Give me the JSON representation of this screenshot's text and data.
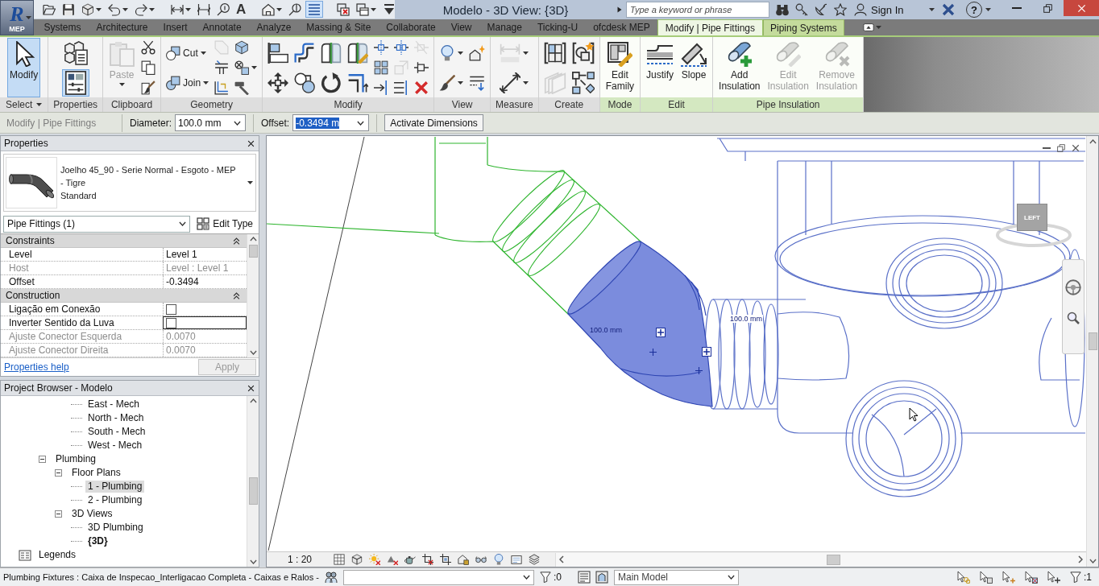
{
  "app_button": {
    "logo": "R",
    "label": "MEP"
  },
  "quick_access": [
    {
      "menu": false,
      "on": false
    },
    {
      "menu": false,
      "on": false
    },
    {
      "menu": true,
      "on": false
    },
    {
      "menu": true,
      "on": false
    },
    {
      "menu": true,
      "on": false
    },
    {
      "menu": true,
      "on": false
    },
    {
      "menu": false,
      "on": false
    },
    {
      "menu": false,
      "on": false
    },
    {
      "glyph": "A",
      "menu": false,
      "on": false
    },
    {
      "menu": true,
      "on": false
    },
    {
      "menu": false,
      "on": false
    },
    {
      "menu": false,
      "on": true
    },
    {
      "menu": false,
      "on": false
    },
    {
      "menu": true,
      "on": false
    },
    {
      "menu": false,
      "on": false
    }
  ],
  "window": {
    "title": "Modelo - 3D View: {3D}"
  },
  "search": {
    "placeholder": "Type a keyword or phrase"
  },
  "account": {
    "label": "Sign In"
  },
  "help": {
    "glyph": "?"
  },
  "ribbon_tabs": [
    {
      "label": "Systems",
      "selected": false,
      "contextual": false
    },
    {
      "label": "Architecture",
      "selected": false,
      "contextual": false
    },
    {
      "label": "Insert",
      "selected": false,
      "contextual": false
    },
    {
      "label": "Annotate",
      "selected": false,
      "contextual": false
    },
    {
      "label": "Analyze",
      "selected": false,
      "contextual": false
    },
    {
      "label": "Massing & Site",
      "selected": false,
      "contextual": false
    },
    {
      "label": "Collaborate",
      "selected": false,
      "contextual": false
    },
    {
      "label": "View",
      "selected": false,
      "contextual": false
    },
    {
      "label": "Manage",
      "selected": false,
      "contextual": false
    },
    {
      "label": "Ticking-U",
      "selected": false,
      "contextual": false
    },
    {
      "label": "ofcdesk MEP",
      "selected": false,
      "contextual": false
    },
    {
      "label": "Modify | Pipe Fittings",
      "selected": true,
      "contextual": true
    },
    {
      "label": "Piping Systems",
      "selected": false,
      "contextual": true
    }
  ],
  "ribbon_panels": [
    {
      "label": "Select",
      "menu": true,
      "contextual": false,
      "columns": [
        {
          "kind": "large",
          "tools": [
            {
              "label": "Modify",
              "menu": false,
              "disabled": false,
              "active": true
            }
          ]
        }
      ]
    },
    {
      "label": "Properties",
      "menu": false,
      "contextual": false,
      "columns": [
        {
          "kind": "stack",
          "tools": [
            {
              "menu": false,
              "disabled": false,
              "active": false
            },
            {
              "menu": false,
              "disabled": false,
              "active": true
            }
          ]
        }
      ]
    },
    {
      "label": "Clipboard",
      "menu": false,
      "contextual": false,
      "columns": [
        {
          "kind": "large",
          "tools": [
            {
              "label": "Paste",
              "menu": true,
              "disabled": true,
              "active": false
            }
          ]
        },
        {
          "kind": "stack",
          "tools": [
            {
              "menu": false,
              "disabled": false,
              "active": false
            },
            {
              "menu": false,
              "disabled": false,
              "active": false
            },
            {
              "menu": false,
              "disabled": false,
              "active": false
            }
          ]
        }
      ]
    },
    {
      "label": "Geometry",
      "menu": false,
      "contextual": false,
      "columns": [
        {
          "kind": "stack",
          "tools": [
            {
              "label": "Cut",
              "menu": true,
              "disabled": false,
              "active": false
            },
            {
              "label": "Join",
              "menu": true,
              "disabled": false,
              "active": false
            }
          ]
        },
        {
          "kind": "stack",
          "tools": [
            {
              "menu": false,
              "disabled": true,
              "active": false
            },
            {
              "menu": false,
              "disabled": false,
              "active": false
            },
            {
              "menu": false,
              "disabled": false,
              "active": false
            }
          ]
        },
        {
          "kind": "stack",
          "tools": [
            {
              "menu": false,
              "disabled": false,
              "active": false
            },
            {
              "menu": true,
              "disabled": false,
              "active": false
            },
            {
              "menu": false,
              "disabled": false,
              "active": false
            }
          ]
        }
      ]
    },
    {
      "label": "Modify",
      "menu": false,
      "contextual": false,
      "columns": [
        {
          "kind": "stack",
          "tools": [
            {
              "menu": false,
              "disabled": false,
              "active": false
            },
            {
              "menu": false,
              "disabled": false,
              "active": false
            }
          ]
        },
        {
          "kind": "stack",
          "tools": [
            {
              "menu": false,
              "disabled": false,
              "active": false
            },
            {
              "menu": false,
              "disabled": false,
              "active": false
            }
          ]
        },
        {
          "kind": "stack",
          "tools": [
            {
              "menu": false,
              "disabled": false,
              "active": false
            },
            {
              "menu": false,
              "disabled": false,
              "active": false
            }
          ]
        },
        {
          "kind": "stack",
          "tools": [
            {
              "menu": false,
              "disabled": false,
              "active": false
            },
            {
              "menu": false,
              "disabled": false,
              "active": false
            }
          ]
        },
        {
          "kind": "stack",
          "tools": [
            {
              "menu": false,
              "disabled": false,
              "active": false
            },
            {
              "menu": false,
              "disabled": false,
              "active": false
            },
            {
              "menu": false,
              "disabled": false,
              "active": false
            }
          ]
        },
        {
          "kind": "stack",
          "tools": [
            {
              "menu": false,
              "disabled": false,
              "active": false
            },
            {
              "menu": false,
              "disabled": true,
              "active": false
            },
            {
              "menu": false,
              "disabled": false,
              "active": false
            }
          ]
        },
        {
          "kind": "stack",
          "tools": [
            {
              "menu": false,
              "disabled": true,
              "active": false
            },
            {
              "menu": false,
              "disabled": false,
              "active": false
            },
            {
              "menu": false,
              "disabled": false,
              "active": false
            }
          ]
        }
      ]
    },
    {
      "label": "View",
      "menu": false,
      "contextual": false,
      "columns": [
        {
          "kind": "stack",
          "tools": [
            {
              "menu": true,
              "disabled": false,
              "active": false
            },
            {
              "menu": true,
              "disabled": false,
              "active": false
            }
          ]
        },
        {
          "kind": "stack",
          "tools": [
            {
              "menu": false,
              "disabled": false,
              "active": false
            },
            {
              "menu": false,
              "disabled": false,
              "active": false
            }
          ]
        }
      ]
    },
    {
      "label": "Measure",
      "menu": false,
      "contextual": false,
      "columns": [
        {
          "kind": "stack",
          "tools": [
            {
              "menu": true,
              "disabled": true,
              "active": false
            },
            {
              "menu": true,
              "disabled": false,
              "active": false
            }
          ]
        }
      ]
    },
    {
      "label": "Create",
      "menu": false,
      "contextual": false,
      "columns": [
        {
          "kind": "stack",
          "tools": [
            {
              "menu": false,
              "disabled": false,
              "active": false
            },
            {
              "menu": false,
              "disabled": true,
              "active": false
            }
          ]
        },
        {
          "kind": "stack",
          "tools": [
            {
              "menu": false,
              "disabled": false,
              "active": false
            },
            {
              "menu": false,
              "disabled": false,
              "active": false
            }
          ]
        }
      ]
    },
    {
      "label": "Mode",
      "menu": false,
      "contextual": true,
      "columns": [
        {
          "kind": "large",
          "tools": [
            {
              "label": "Edit Family",
              "menu": false,
              "disabled": false,
              "active": false
            }
          ]
        }
      ]
    },
    {
      "label": "Edit",
      "menu": false,
      "contextual": true,
      "columns": [
        {
          "kind": "large",
          "tools": [
            {
              "label": "Justify",
              "menu": false,
              "disabled": false,
              "active": false
            }
          ]
        },
        {
          "kind": "large",
          "tools": [
            {
              "label": "Slope",
              "menu": false,
              "disabled": false,
              "active": false
            }
          ]
        }
      ]
    },
    {
      "label": "Pipe Insulation",
      "menu": false,
      "contextual": true,
      "columns": [
        {
          "kind": "large",
          "tools": [
            {
              "label": "Add Insulation",
              "menu": false,
              "disabled": false,
              "active": false
            }
          ]
        },
        {
          "kind": "large",
          "tools": [
            {
              "label": "Edit Insulation",
              "menu": false,
              "disabled": true,
              "active": false
            }
          ]
        },
        {
          "kind": "large",
          "tools": [
            {
              "label": "Remove Insulation",
              "menu": false,
              "disabled": true,
              "active": false
            }
          ]
        }
      ]
    }
  ],
  "options_bar": {
    "context": "Modify | Pipe Fittings",
    "fields": [
      {
        "label": "Diameter:",
        "value": "100.0 mm",
        "text_selected": false
      },
      {
        "label": "Offset:",
        "value": "-0.3494 m",
        "text_selected": true
      }
    ],
    "button": "Activate Dimensions"
  },
  "properties": {
    "title": "Properties",
    "type": {
      "name": "Joelho 45_90 - Serie Normal - Esgoto - MEP - Tigre",
      "subtype": "Standard"
    },
    "filter": "Pipe Fittings (1)",
    "edit_type": "Edit Type",
    "groups": [
      {
        "label": "Constraints",
        "expanded": true,
        "rows": [
          {
            "name": "Level",
            "kind": "text",
            "value": "Level 1",
            "disabled": false
          },
          {
            "name": "Host",
            "kind": "text",
            "value": "Level : Level 1",
            "disabled": true
          },
          {
            "name": "Offset",
            "kind": "text",
            "value": "-0.3494",
            "disabled": false
          }
        ]
      },
      {
        "label": "Construction",
        "expanded": true,
        "rows": [
          {
            "name": "Ligação em Conexão",
            "kind": "checkbox",
            "checked": false,
            "focused": false,
            "disabled": false
          },
          {
            "name": "Inverter Sentido da Luva",
            "kind": "checkbox",
            "checked": false,
            "focused": true,
            "disabled": false
          },
          {
            "name": "Ajuste Conector Esquerda",
            "kind": "text",
            "value": "0.0070",
            "disabled": true
          },
          {
            "name": "Ajuste Conector Direita",
            "kind": "text",
            "value": "0.0070",
            "disabled": true
          }
        ]
      }
    ],
    "help_link": "Properties help",
    "apply": "Apply",
    "apply_disabled": true
  },
  "project_browser": {
    "title": "Project Browser - Modelo",
    "tree": [
      {
        "children": [
          {
            "children": [
              {
                "children": [
                  {
                    "label": "East - Mech",
                    "selected": false,
                    "current": false
                  },
                  {
                    "label": "North - Mech",
                    "selected": false,
                    "current": false
                  },
                  {
                    "label": "South - Mech",
                    "selected": false,
                    "current": false
                  },
                  {
                    "label": "West - Mech",
                    "selected": false,
                    "current": false
                  }
                ]
              }
            ]
          },
          {
            "label": "Plumbing",
            "expanded": true,
            "selected": false,
            "current": false,
            "children": [
              {
                "label": "Floor Plans",
                "expanded": true,
                "selected": false,
                "current": false,
                "children": [
                  {
                    "label": "1 - Plumbing",
                    "selected": true,
                    "current": false
                  },
                  {
                    "label": "2 - Plumbing",
                    "selected": false,
                    "current": false
                  }
                ]
              },
              {
                "label": "3D Views",
                "expanded": true,
                "selected": false,
                "current": false,
                "children": [
                  {
                    "label": "3D Plumbing",
                    "selected": false,
                    "current": false
                  },
                  {
                    "label": "{3D}",
                    "selected": false,
                    "current": true
                  }
                ]
              }
            ]
          }
        ]
      },
      {
        "label": "Legends",
        "selected": false,
        "current": false
      }
    ]
  },
  "viewport": {
    "dimension_labels": [
      "100.0 mm",
      "100.0 mm"
    ],
    "viewcube_face": "LEFT",
    "scale": "1 : 20"
  },
  "status_bar": {
    "message": "Plumbing Fixtures : Caixa de Inspecao_Interligacao Completa - Caixas e Ralos -",
    "selection_count": ":0",
    "design_option": "Main Model",
    "filter_count": ":1"
  }
}
